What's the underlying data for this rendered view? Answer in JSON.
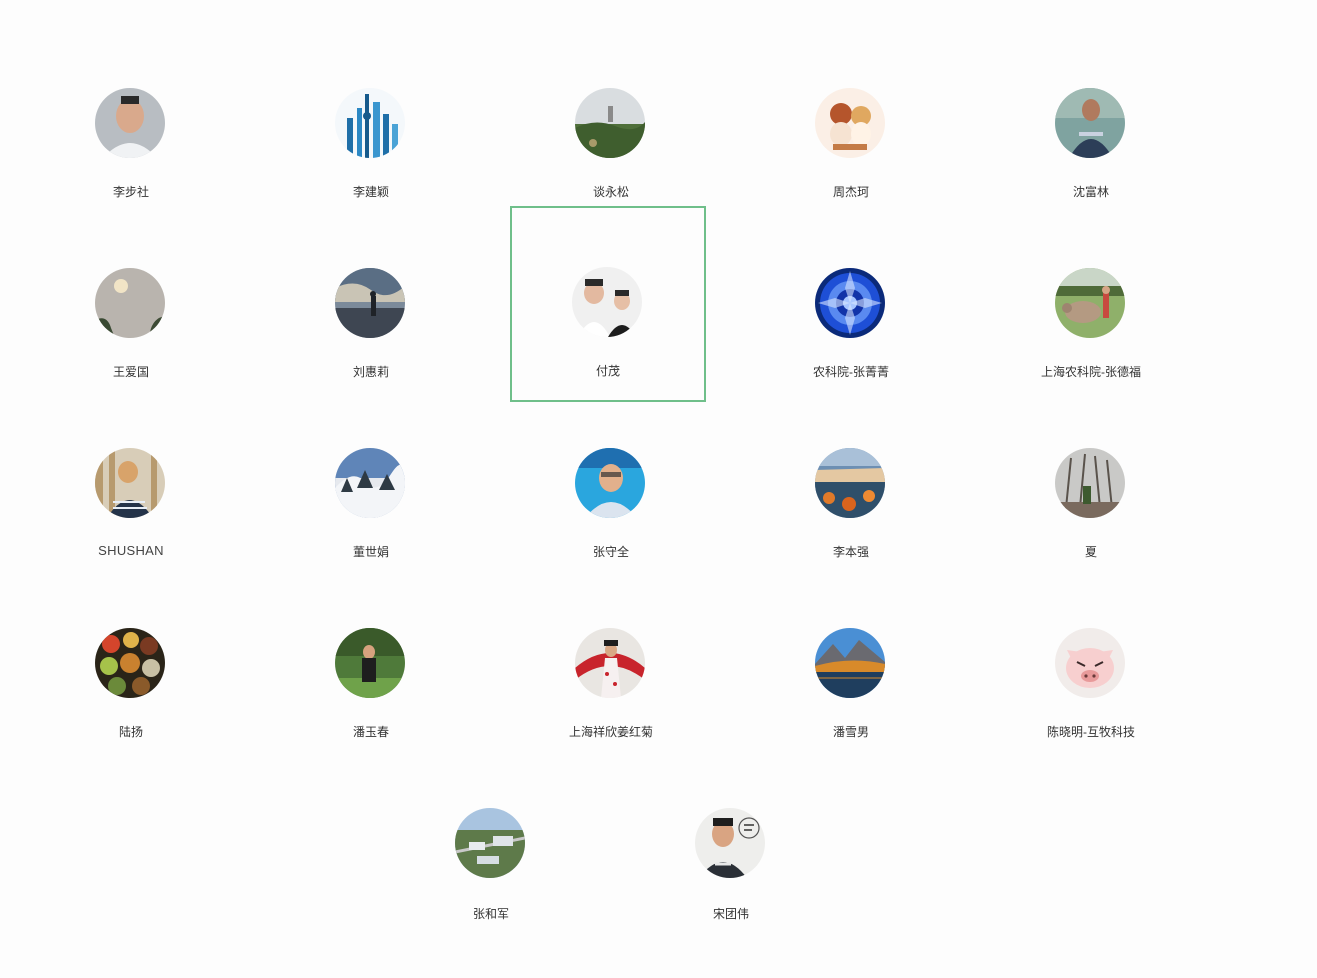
{
  "members": [
    {
      "name": "李步社"
    },
    {
      "name": "李建颖"
    },
    {
      "name": "谈永松"
    },
    {
      "name": "周杰珂"
    },
    {
      "name": "沈富林"
    },
    {
      "name": "王爱国"
    },
    {
      "name": "刘惠莉"
    },
    {
      "name": "付茂"
    },
    {
      "name": "农科院-张菁菁"
    },
    {
      "name": "上海农科院-张德福"
    },
    {
      "name": "SHUSHAN"
    },
    {
      "name": "董世娟"
    },
    {
      "name": "张守全"
    },
    {
      "name": "李本强"
    },
    {
      "name": "夏"
    },
    {
      "name": "陆扬"
    },
    {
      "name": "潘玉春"
    },
    {
      "name": "上海祥欣姜红菊"
    },
    {
      "name": "潘雪男"
    },
    {
      "name": "陈晓明-互牧科技"
    },
    {
      "name": "张和军"
    },
    {
      "name": "宋团伟"
    }
  ],
  "selected_member": "付茂",
  "colors": {
    "background": "#fdfdfd",
    "selection_border": "#6fbf8a",
    "name_text": "#333333"
  }
}
